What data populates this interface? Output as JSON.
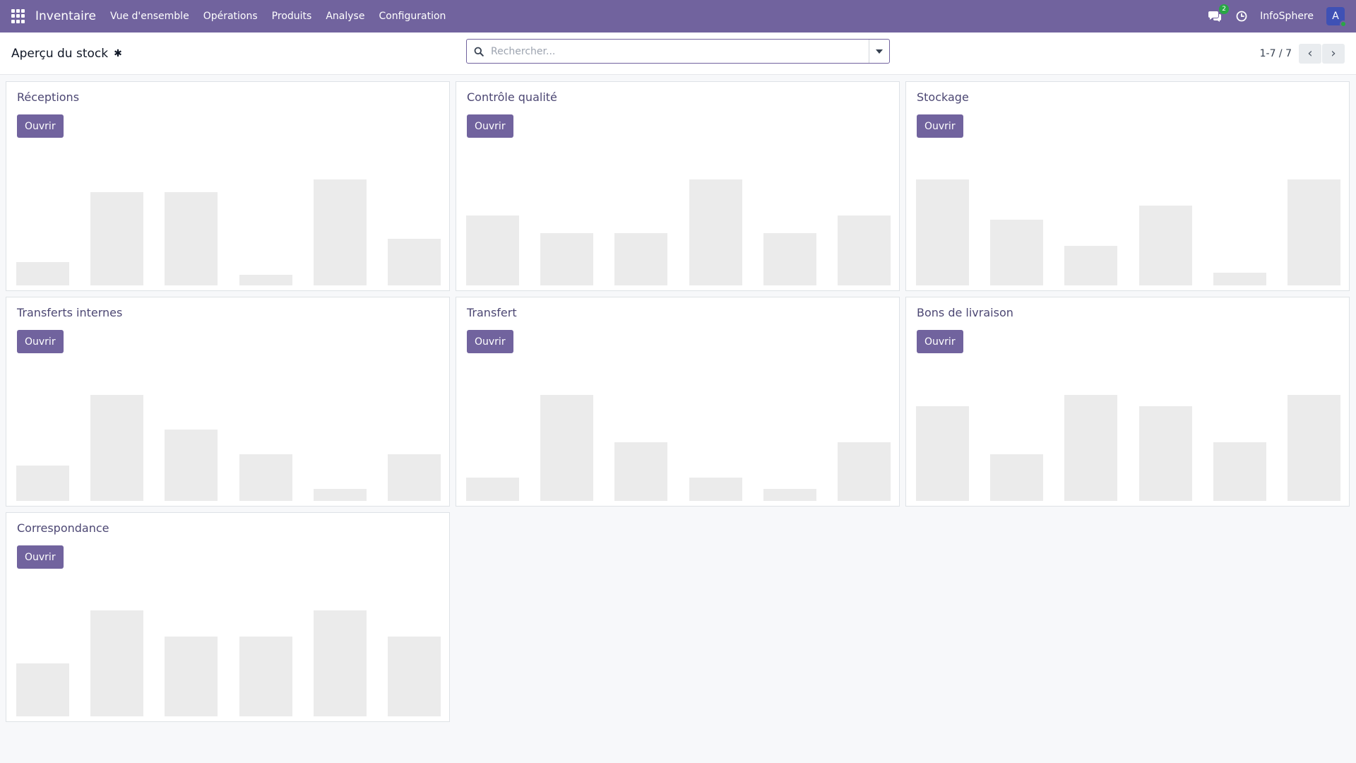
{
  "navbar": {
    "brand": "Inventaire",
    "menu": [
      "Vue d'ensemble",
      "Opérations",
      "Produits",
      "Analyse",
      "Configuration"
    ],
    "chat_count": "2",
    "company": "InfoSphere",
    "avatar_letter": "A"
  },
  "control": {
    "title": "Aperçu du stock",
    "search_placeholder": "Rechercher...",
    "pager": "1-7 / 7"
  },
  "open_label": "Ouvrir",
  "cards": [
    {
      "title": "Réceptions",
      "bars": [
        0.22,
        0.88,
        0.88,
        0.1,
        1.0,
        0.44
      ]
    },
    {
      "title": "Contrôle qualité",
      "bars": [
        0.66,
        0.49,
        0.49,
        1.0,
        0.49,
        0.66
      ]
    },
    {
      "title": "Stockage",
      "bars": [
        1.0,
        0.62,
        0.37,
        0.75,
        0.12,
        1.0
      ]
    },
    {
      "title": "Transferts internes",
      "bars": [
        0.33,
        1.0,
        0.67,
        0.44,
        0.11,
        0.44
      ]
    },
    {
      "title": "Transfert",
      "bars": [
        0.22,
        1.0,
        0.55,
        0.22,
        0.11,
        0.55
      ]
    },
    {
      "title": "Bons de livraison",
      "bars": [
        0.89,
        0.44,
        1.0,
        0.89,
        0.55,
        1.0
      ]
    },
    {
      "title": "Correspondance",
      "bars": [
        0.5,
        1.0,
        0.75,
        0.75,
        1.0,
        0.75
      ]
    }
  ]
}
